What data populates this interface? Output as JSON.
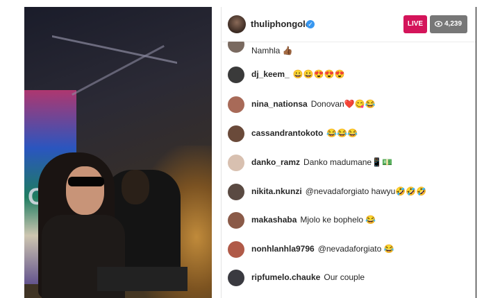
{
  "host": {
    "username": "thuliphongolo",
    "verified": true
  },
  "live": {
    "label": "LIVE",
    "viewers": "4,239"
  },
  "comments": [
    {
      "user": "",
      "text": "Namhla 👍🏾",
      "partial": true
    },
    {
      "user": "dj_keem_",
      "text": "😀😀😍😍😍"
    },
    {
      "user": "nina_nationsa",
      "text": "Donovan❤️😋😂"
    },
    {
      "user": "cassandrantokoto",
      "text": "😂😂😂"
    },
    {
      "user": "danko_ramz",
      "text": "Danko madumane📱💵"
    },
    {
      "user": "nikita.nkunzi",
      "text": "@nevadaforgiato hawyu🤣🤣🤣"
    },
    {
      "user": "makashaba",
      "text": "Mjolo ke bophelo 😂"
    },
    {
      "user": "nonhlanhla9796",
      "text": "@nevadaforgiato 😂"
    },
    {
      "user": "ripfumelo.chauke",
      "text": "Our couple"
    }
  ],
  "colors": {
    "live": "#d4145a",
    "viewer_badge": "#777777",
    "verified": "#3897f0"
  },
  "icons": {
    "verified": "verified-badge-icon",
    "viewers": "eye-icon"
  }
}
